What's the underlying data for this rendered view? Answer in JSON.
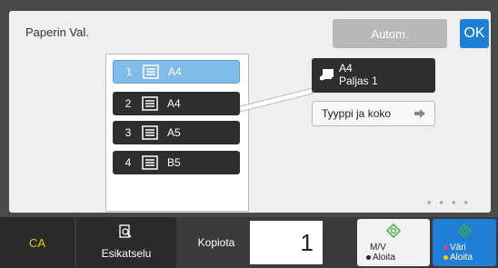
{
  "header": {
    "title": "Paperin Val.",
    "autom_label": "Autom.",
    "ok_label": "OK"
  },
  "trays": [
    {
      "num": "1",
      "size": "A4",
      "selected": true
    },
    {
      "num": "2",
      "size": "A4",
      "selected": false
    },
    {
      "num": "3",
      "size": "A5",
      "selected": false
    },
    {
      "num": "4",
      "size": "B5",
      "selected": false
    }
  ],
  "info": {
    "size": "A4",
    "type": "Paljas 1",
    "type_button": "Tyyppi ja koko"
  },
  "bottom": {
    "ca_label": "CA",
    "preview_label": "Esikatselu",
    "copies_label": "Kopiota",
    "copies_value": "1",
    "mono_start": {
      "line1": "M/V",
      "line2": "Aloita"
    },
    "color_start": {
      "line1": "Väri",
      "line2": "Aloita"
    }
  },
  "colors": {
    "accent": "#1f7fd6",
    "selected_tray": "#7fbde8",
    "ca": "#f0c000",
    "start_icon": "#3cb043"
  },
  "icons": [
    "tray-icon",
    "paper-hand-icon",
    "arrow-right-icon",
    "preview-icon",
    "start-diamond-icon"
  ]
}
